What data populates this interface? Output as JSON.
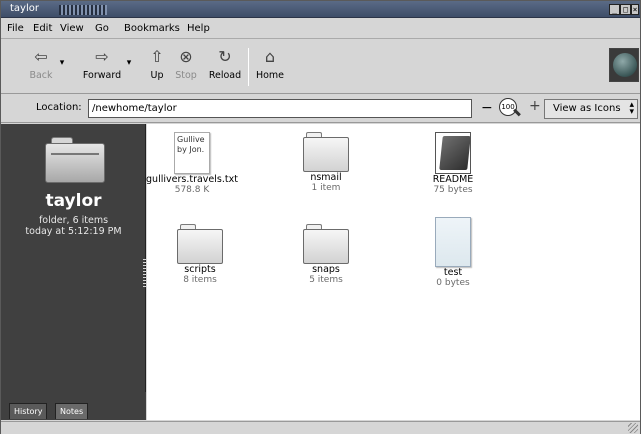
{
  "window": {
    "title": "taylor"
  },
  "menu": [
    "File",
    "Edit",
    "View",
    "Go",
    "Bookmarks",
    "Help"
  ],
  "toolbar": {
    "back": "Back",
    "forward": "Forward",
    "up": "Up",
    "stop": "Stop",
    "reload": "Reload",
    "home": "Home"
  },
  "location": {
    "label": "Location:",
    "value": "/newhome/taylor",
    "zoom": "100"
  },
  "view_as": "View as Icons",
  "sidebar": {
    "name": "taylor",
    "info1": "folder, 6 items",
    "info2": "today at 5:12:19 PM",
    "tabs": [
      "History",
      "Notes"
    ]
  },
  "items": [
    {
      "name": "gullivers.travels.txt",
      "info": "578.8 K",
      "preview": "Gullive by Jon."
    },
    {
      "name": "nsmail",
      "info": "1 item"
    },
    {
      "name": "README",
      "info": "75 bytes"
    },
    {
      "name": "scripts",
      "info": "8 items"
    },
    {
      "name": "snaps",
      "info": "5 items"
    },
    {
      "name": "test",
      "info": "0 bytes"
    }
  ]
}
